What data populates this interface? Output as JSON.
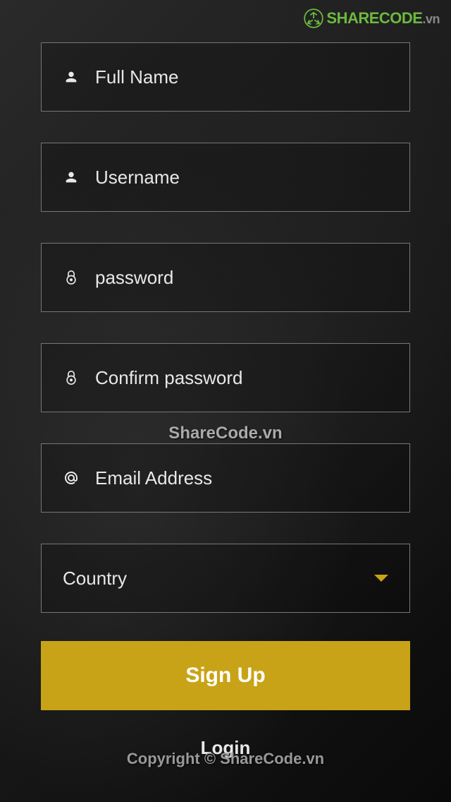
{
  "watermark": {
    "logo_text_green": "SHARECODE",
    "logo_text_gray": ".vn",
    "center_text": "ShareCode.vn",
    "bottom_text": "Copyright © ShareCode.vn"
  },
  "form": {
    "full_name": {
      "placeholder": "Full Name",
      "value": ""
    },
    "username": {
      "placeholder": "Username",
      "value": ""
    },
    "password": {
      "placeholder": "password",
      "value": ""
    },
    "confirm_password": {
      "placeholder": "Confirm password",
      "value": ""
    },
    "email": {
      "placeholder": "Email Address",
      "value": ""
    },
    "country": {
      "label": "Country",
      "selected": ""
    }
  },
  "buttons": {
    "signup": "Sign Up",
    "login": "Login"
  },
  "colors": {
    "accent": "#c9a317",
    "border": "#777777",
    "logo_green": "#6db93f"
  }
}
